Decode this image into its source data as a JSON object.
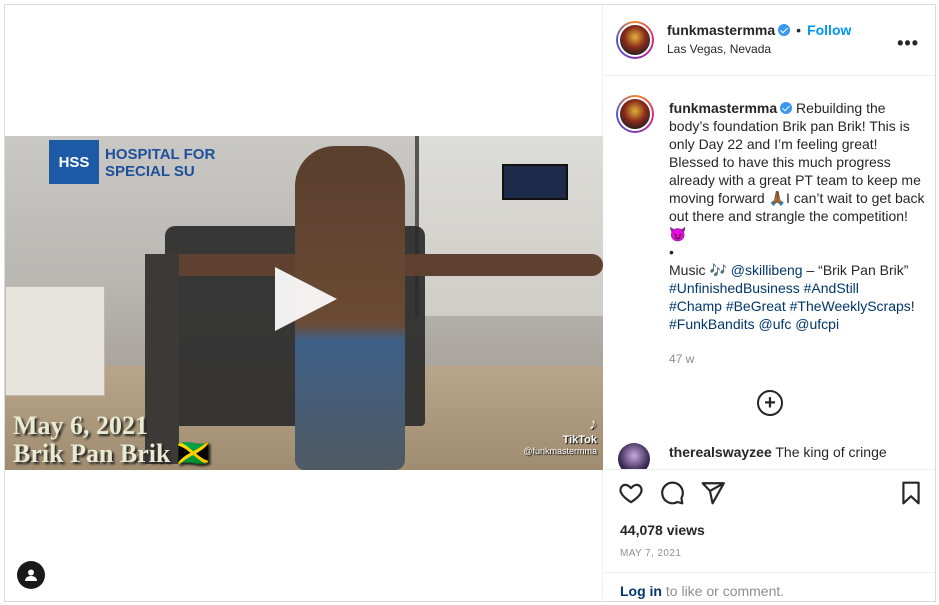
{
  "header": {
    "username": "funkmastermma",
    "separator": "•",
    "follow_label": "Follow",
    "location": "Las Vegas, Nevada",
    "more_label": "•••"
  },
  "video": {
    "sign_hss": "HSS",
    "sign_text": "HOSPITAL FOR\nSPECIAL SU",
    "date_text": "May 6, 2021",
    "subtitle_text": "Brik Pan Brik 🇯🇲",
    "tiktok_label": "TikTok",
    "tiktok_handle": "@funkmastermma"
  },
  "caption": {
    "username": "funkmastermma",
    "text_1": " Rebuilding the body’s foundation Brik pan Brik! This is only Day 22 and I’m feeling great! Blessed to have this much progress already with a great PT team to keep me moving forward 🙏🏾I can’t wait to get back out there and strangle the competition! 😈",
    "bullet": "•",
    "music_prefix": "Music 🎶 ",
    "music_mention": "@skillibeng",
    "music_suffix": " – “Brik Pan Brik”",
    "tag1": "#UnfinishedBusiness",
    "tag2": "#AndStill",
    "tag3": "#Champ",
    "tag4": "#BeGreat",
    "tag5": "#TheWeeklyScraps",
    "tag5_suffix": "!",
    "tag6": "#FunkBandits",
    "mention_ufc": "@ufc",
    "mention_ufcpi": "@ufcpi",
    "time": "47 w"
  },
  "load_more_label": "+",
  "comment": {
    "username": "therealswayzee",
    "text": " The king of cringe"
  },
  "stats": {
    "views": "44,078 views",
    "date": "MAY 7, 2021"
  },
  "login_bar": {
    "login_label": "Log in",
    "rest": " to like or comment."
  },
  "colors": {
    "accent": "#0095f6",
    "link": "#00376b",
    "verified": "#3897f0",
    "muted": "#8e8e8e"
  }
}
